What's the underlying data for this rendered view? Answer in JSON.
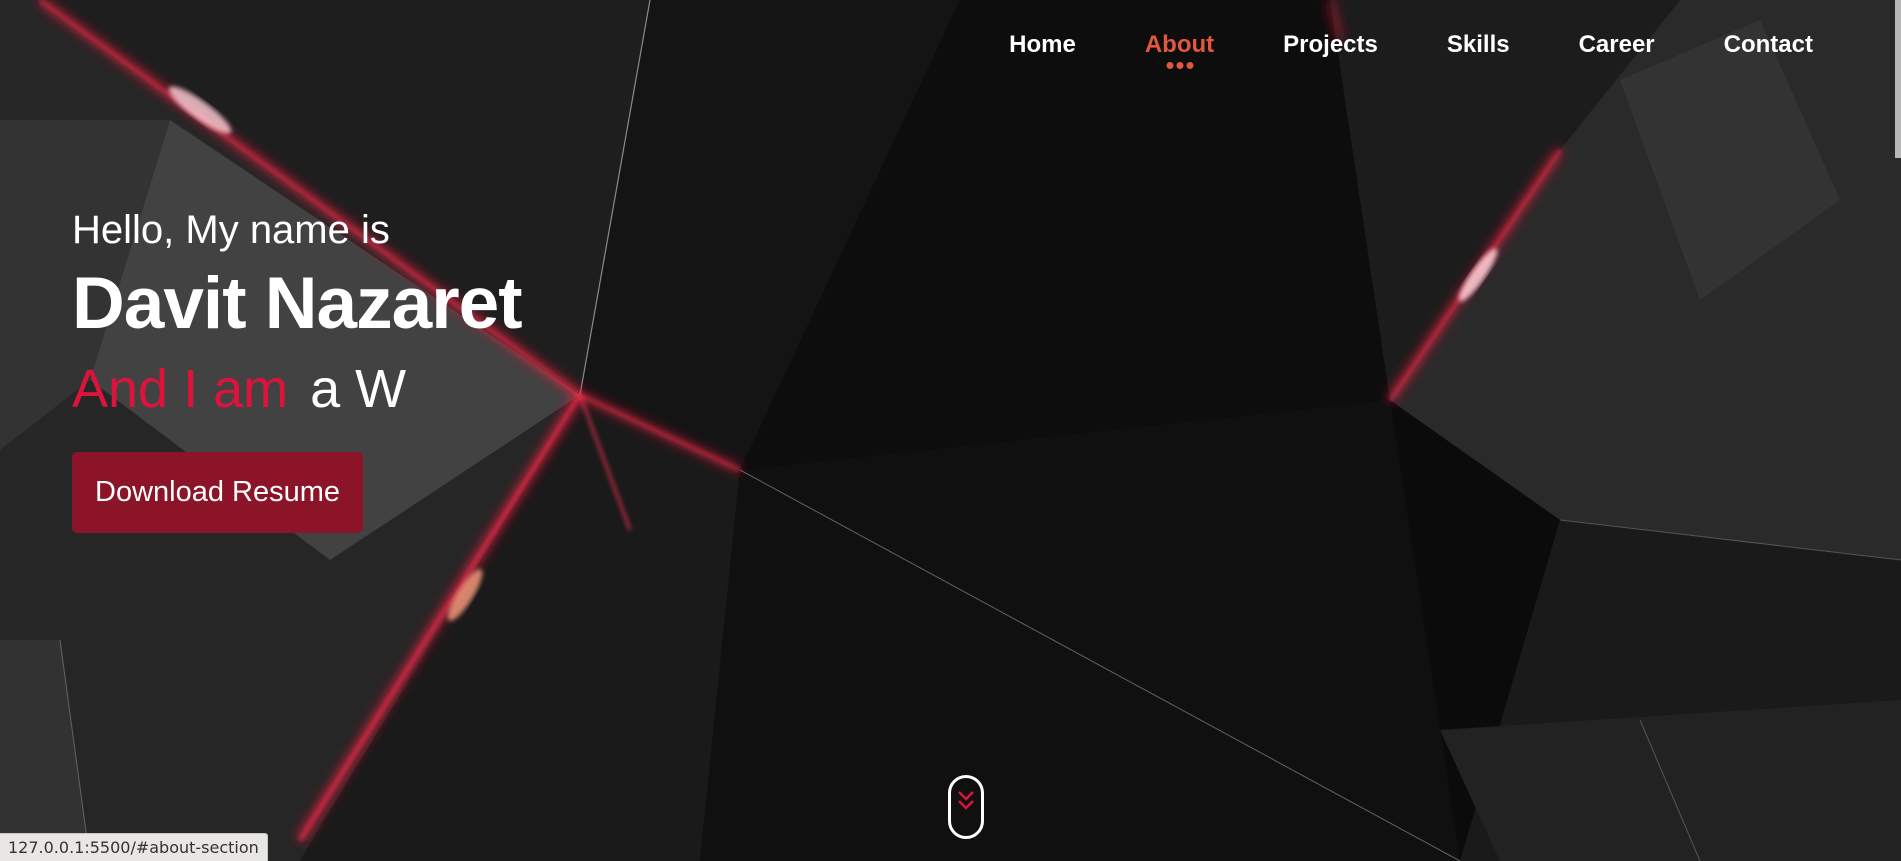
{
  "colors": {
    "accent": "#e2583e",
    "crimson": "#dc143c",
    "button": "#8b1428",
    "background": "#0a0a0a"
  },
  "nav": {
    "items": [
      {
        "label": "Home",
        "active": false
      },
      {
        "label": "About",
        "active": true
      },
      {
        "label": "Projects",
        "active": false
      },
      {
        "label": "Skills",
        "active": false
      },
      {
        "label": "Career",
        "active": false
      },
      {
        "label": "Contact",
        "active": false
      }
    ]
  },
  "hero": {
    "greeting": "Hello, My name is",
    "name": "Davit Nazaret",
    "role_prefix": "And I am",
    "role_typed": "a W",
    "button_label": "Download Resume"
  },
  "scroll_indicator": {
    "icon": "chevron-double-down-icon"
  },
  "status_bar": {
    "url": "127.0.0.1:5500/#about-section"
  }
}
